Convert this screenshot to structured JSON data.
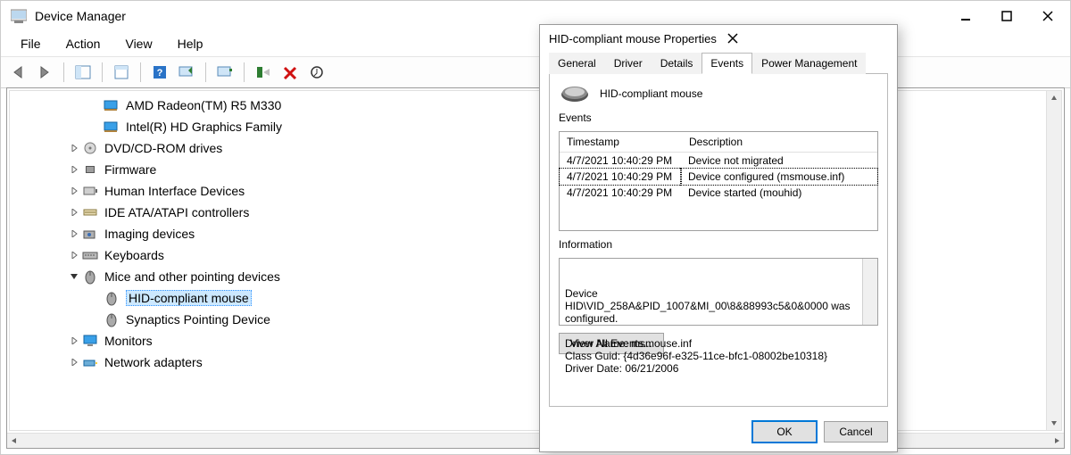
{
  "window": {
    "title": "Device Manager"
  },
  "menu": [
    "File",
    "Action",
    "View",
    "Help"
  ],
  "tree": [
    {
      "depth": 2,
      "icon": "gpu-icon",
      "label": "AMD Radeon(TM) R5 M330"
    },
    {
      "depth": 2,
      "icon": "gpu-icon",
      "label": "Intel(R) HD Graphics Family"
    },
    {
      "depth": 1,
      "caret": "r",
      "icon": "disc-icon",
      "label": "DVD/CD-ROM drives"
    },
    {
      "depth": 1,
      "caret": "r",
      "icon": "chip-icon",
      "label": "Firmware"
    },
    {
      "depth": 1,
      "caret": "r",
      "icon": "hid-icon",
      "label": "Human Interface Devices"
    },
    {
      "depth": 1,
      "caret": "r",
      "icon": "ide-icon",
      "label": "IDE ATA/ATAPI controllers"
    },
    {
      "depth": 1,
      "caret": "r",
      "icon": "camera-icon",
      "label": "Imaging devices"
    },
    {
      "depth": 1,
      "caret": "r",
      "icon": "keyboard-icon",
      "label": "Keyboards"
    },
    {
      "depth": 1,
      "caret": "d",
      "icon": "mouse-icon",
      "label": "Mice and other pointing devices"
    },
    {
      "depth": 2,
      "icon": "mouse-icon",
      "label": "HID-compliant mouse",
      "selected": true
    },
    {
      "depth": 2,
      "icon": "mouse-icon",
      "label": "Synaptics Pointing Device"
    },
    {
      "depth": 1,
      "caret": "r",
      "icon": "monitor-icon",
      "label": "Monitors"
    },
    {
      "depth": 1,
      "caret": "r",
      "icon": "network-icon",
      "label": "Network adapters"
    }
  ],
  "dialog": {
    "title": "HID-compliant mouse Properties",
    "tabs": [
      "General",
      "Driver",
      "Details",
      "Events",
      "Power Management"
    ],
    "activeTab": "Events",
    "deviceName": "HID-compliant mouse",
    "eventsLabel": "Events",
    "columns": {
      "timestamp": "Timestamp",
      "description": "Description"
    },
    "events": [
      {
        "ts": "4/7/2021 10:40:29 PM",
        "desc": "Device not migrated"
      },
      {
        "ts": "4/7/2021 10:40:29 PM",
        "desc": "Device configured (msmouse.inf)",
        "selected": true
      },
      {
        "ts": "4/7/2021 10:40:29 PM",
        "desc": "Device started (mouhid)"
      }
    ],
    "infoLabel": "Information",
    "infoText": "Device HID\\VID_258A&PID_1007&MI_00\\8&88993c5&0&0000 was configured.\n\nDriver Name: msmouse.inf\nClass Guid: {4d36e96f-e325-11ce-bfc1-08002be10318}\nDriver Date: 06/21/2006",
    "viewAll": "View All Events...",
    "ok": "OK",
    "cancel": "Cancel"
  }
}
